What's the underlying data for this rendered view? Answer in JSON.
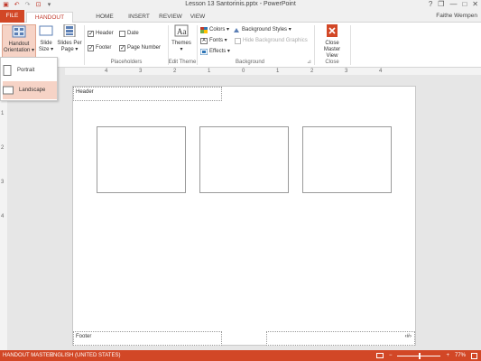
{
  "window": {
    "title": "Lesson 13 Santorinis.pptx - PowerPoint",
    "user": "Faithe Wempen",
    "help": "?",
    "restore": "❐",
    "minimize": "—",
    "maximize": "□",
    "close": "✕"
  },
  "qat": {
    "save": "▣",
    "undo": "↶",
    "redo": "↷",
    "start": "⊡",
    "customize": "▾"
  },
  "tabs": [
    "FILE",
    "HANDOUT MASTER",
    "HOME",
    "INSERT",
    "REVIEW",
    "VIEW"
  ],
  "ribbon": {
    "page_setup": {
      "handout_orientation": "Handout Orientation ▾",
      "slide_size": "Slide Size ▾",
      "slides_per_page": "Slides Per Page ▾"
    },
    "placeholders": {
      "label": "Placeholders",
      "header": "Header",
      "date": "Date",
      "footer": "Footer",
      "page_number": "Page Number"
    },
    "edit_theme": {
      "label": "Edit Theme",
      "themes": "Themes ▾"
    },
    "background": {
      "label": "Background",
      "colors": "Colors ▾",
      "fonts": "Fonts ▾",
      "effects": "Effects ▾",
      "background_styles": "Background Styles ▾",
      "hide_background_graphics": "Hide Background Graphics",
      "launcher": "⊿"
    },
    "close": {
      "label": "Close",
      "close_master_view": "Close Master View"
    }
  },
  "dropdown": {
    "portrait": "Portrait",
    "landscape": "Landscape"
  },
  "ruler_h": [
    "4",
    "3",
    "2",
    "1",
    "0",
    "1",
    "2",
    "3",
    "4"
  ],
  "ruler_v": [
    "1",
    "2",
    "3",
    "4"
  ],
  "page": {
    "header": "Header",
    "footer": "Footer",
    "page_number_glyph": "‹#›"
  },
  "status": {
    "view": "HANDOUT MASTER",
    "language": "ENGLISH (UNITED STATES)",
    "zoom": "77%",
    "zoom_out": "−",
    "zoom_in": "+"
  },
  "colors": {
    "accent": "#d24726",
    "pressed": "#f6d3c6"
  }
}
